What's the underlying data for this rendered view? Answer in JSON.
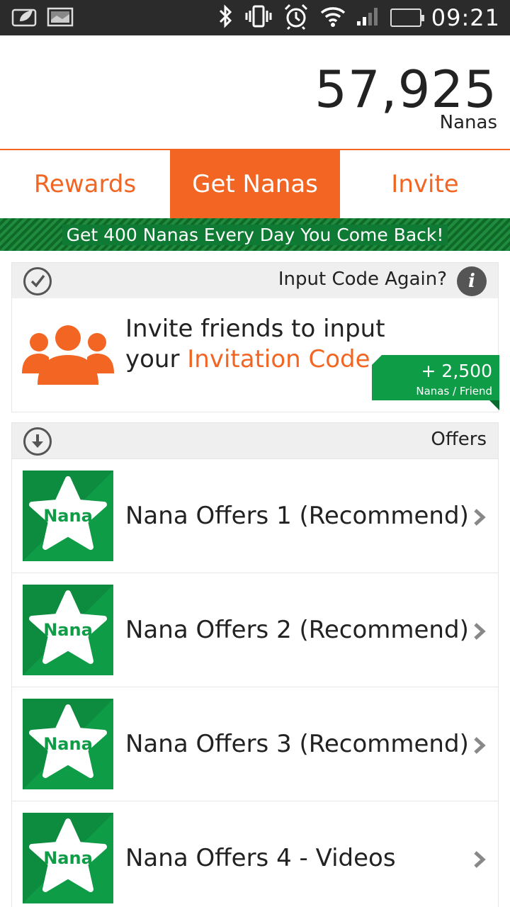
{
  "status_bar": {
    "time": "09:21",
    "icons": [
      "leaf-card-icon",
      "image-icon",
      "bluetooth-icon",
      "vibrate-icon",
      "alarm-icon",
      "wifi-icon",
      "signal-icon",
      "battery-icon"
    ]
  },
  "balance": {
    "value": "57,925",
    "unit": "Nanas"
  },
  "tabs": [
    {
      "label": "Rewards",
      "active": false
    },
    {
      "label": "Get Nanas",
      "active": true
    },
    {
      "label": "Invite",
      "active": false
    }
  ],
  "promo": {
    "text": "Get 400 Nanas Every Day You Come Back!"
  },
  "invite_section": {
    "header": "Input Code Again?",
    "line1": "Invite friends to input",
    "line2_prefix": "your ",
    "line2_highlight": "Invitation Code",
    "line2_suffix": ".",
    "reward_amount": "+ 2,500",
    "reward_per": "Nanas / Friend"
  },
  "offers_section": {
    "header": "Offers",
    "icon_label": "Nana",
    "items": [
      {
        "label": "Nana Offers 1 (Recommend)"
      },
      {
        "label": "Nana Offers 2 (Recommend)"
      },
      {
        "label": "Nana Offers 3 (Recommend)"
      },
      {
        "label": "Nana Offers 4 - Videos"
      }
    ]
  },
  "colors": {
    "accent": "#f26522",
    "green": "#0e9c47",
    "dark_green": "#0f6a2a",
    "status_bar": "#2b2b2b"
  }
}
